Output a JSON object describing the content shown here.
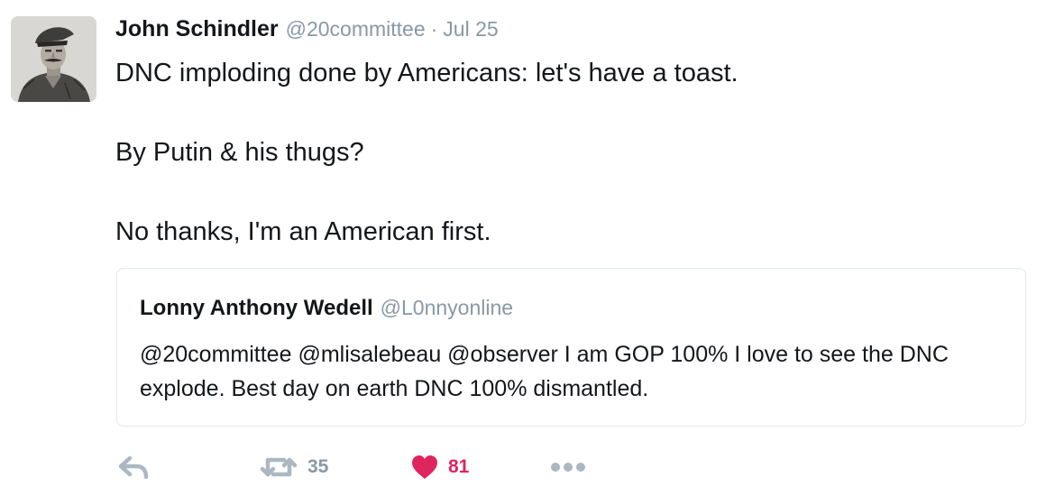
{
  "tweet": {
    "author_name": "John Schindler",
    "author_handle": "@20committee",
    "separator": "·",
    "date": "Jul 25",
    "avatar_icon": "soldier-portrait-avatar",
    "text": {
      "line1": "DNC imploding done by Americans: let's have a toast.",
      "line2": "By Putin & his thugs?",
      "line3": "No thanks, I'm an American first."
    }
  },
  "quoted_tweet": {
    "author_name": "Lonny Anthony Wedell",
    "author_handle": "@L0nnyonline",
    "text": "@20committee @mlisalebeau @observer I am GOP 100% I love to see the DNC explode. Best day on earth DNC 100% dismantled."
  },
  "actions": {
    "reply": {
      "icon": "reply-icon"
    },
    "retweet": {
      "icon": "retweet-icon",
      "count": "35"
    },
    "like": {
      "icon": "heart-icon",
      "count": "81",
      "liked": true
    },
    "more": {
      "icon": "more-dots-icon"
    }
  },
  "colors": {
    "text": "#14171a",
    "secondary": "#8899a6",
    "like": "#e0245e",
    "border": "#e1e8ed",
    "icon": "#aab8c2"
  }
}
